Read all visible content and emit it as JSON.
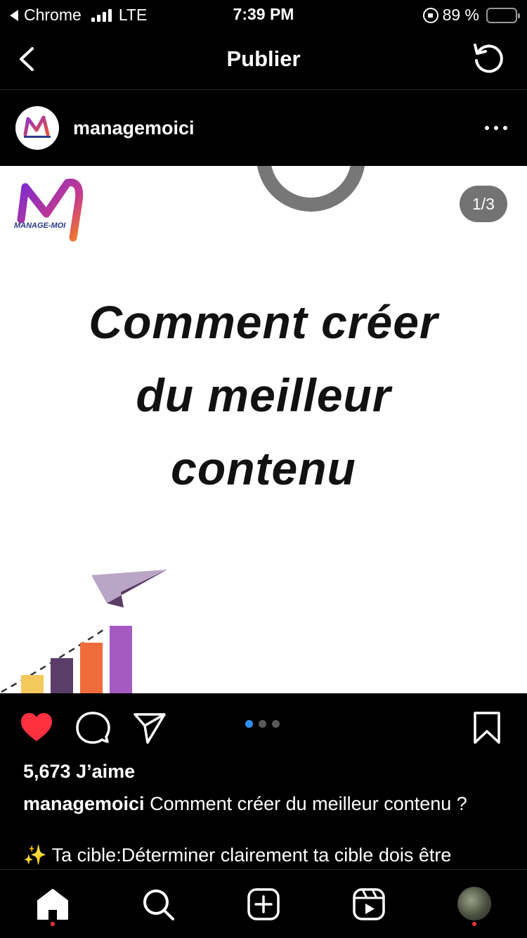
{
  "status_bar": {
    "back_app": "Chrome",
    "network": "LTE",
    "time": "7:39 PM",
    "battery_percent": "89 %",
    "battery_level": 0.89
  },
  "header": {
    "title": "Publier"
  },
  "post": {
    "username": "managemoici",
    "page_indicator": "1/3",
    "current_slide": 1,
    "total_slides": 3,
    "image": {
      "logo_text": "MANAGE-MOI",
      "headline_lines": [
        "Comment créer",
        "du meilleur",
        "contenu"
      ]
    },
    "likes": "5,673 J’aime",
    "caption_username": "managemoici",
    "caption_text": "Comment créer du meilleur contenu ?",
    "caption_line2_emoji": "✨",
    "caption_line2": "Ta cible:Déterminer clairement ta cible dois être"
  },
  "colors": {
    "like_red": "#ff3040",
    "active_dot": "#2f8ff0",
    "battery_yellow": "#f5d247"
  },
  "icons": {
    "back": "chevron-left-icon",
    "refresh": "refresh-icon",
    "more": "more-horizontal-icon",
    "like": "heart-filled-icon",
    "comment": "comment-icon",
    "share": "send-icon",
    "save": "bookmark-icon",
    "nav": [
      "home-icon",
      "search-icon",
      "add-post-icon",
      "reels-icon",
      "profile-avatar"
    ]
  }
}
